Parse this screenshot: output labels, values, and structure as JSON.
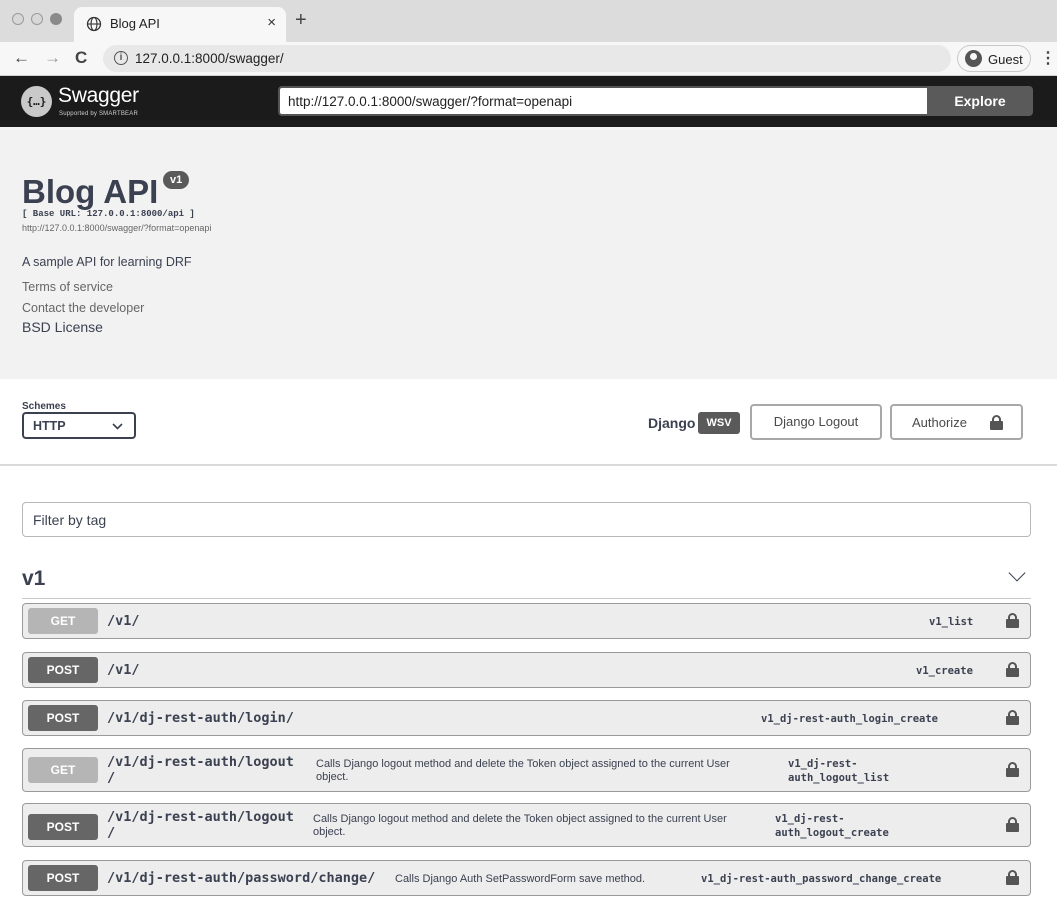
{
  "browser": {
    "tab_title": "Blog API",
    "tab_close": "×",
    "new_tab": "+",
    "back": "←",
    "forward": "→",
    "reload": "C",
    "info": "i",
    "url": "127.0.0.1:8000/swagger/",
    "profile_label": "Guest",
    "menu": "⋮"
  },
  "topbar": {
    "logo_glyph": "{…}",
    "logo_text": "Swagger",
    "logo_sub": "Supported by SMARTBEAR",
    "spec_url": "http://127.0.0.1:8000/swagger/?format=openapi",
    "explore_label": "Explore"
  },
  "info": {
    "title": "Blog API",
    "version": "v1",
    "base_url": "[ Base URL: 127.0.0.1:8000/api ]",
    "spec_link": "http://127.0.0.1:8000/swagger/?format=openapi",
    "description": "A sample API for learning DRF",
    "terms": "Terms of service",
    "contact": "Contact the developer",
    "license": "BSD License"
  },
  "schemes": {
    "label": "Schemes",
    "selected": "HTTP",
    "django_label": "Django",
    "wsv_badge": "WSV",
    "logout_label": "Django Logout",
    "authorize_label": "Authorize"
  },
  "filter": {
    "placeholder": "Filter by tag"
  },
  "tag": {
    "name": "v1"
  },
  "operations": [
    {
      "method": "GET",
      "path": "/v1/",
      "summary": "",
      "operation_id": "v1_list"
    },
    {
      "method": "POST",
      "path": "/v1/",
      "summary": "",
      "operation_id": "v1_create"
    },
    {
      "method": "POST",
      "path": "/v1/dj-rest-auth/login/",
      "summary": "",
      "operation_id": "v1_dj-rest-auth_login_create"
    },
    {
      "method": "GET",
      "path_line1": "/v1/dj-rest-auth/logout",
      "path_line2": "/",
      "summary": "Calls Django logout method and delete the Token object assigned to the current User object.",
      "opid_line1": "v1_dj-rest-",
      "opid_line2": "auth_logout_list"
    },
    {
      "method": "POST",
      "path_line1": "/v1/dj-rest-auth/logout",
      "path_line2": "/",
      "summary": "Calls Django logout method and delete the Token object assigned to the current User object.",
      "opid_line1": "v1_dj-rest-",
      "opid_line2": "auth_logout_create"
    },
    {
      "method": "POST",
      "path": "/v1/dj-rest-auth/password/change/",
      "summary": "Calls Django Auth SetPasswordForm save method.",
      "operation_id": "v1_dj-rest-auth_password_change_create"
    }
  ],
  "colors": {
    "topbar_bg": "#1b1b1b",
    "get_method": "#b5b5b5",
    "post_method": "#666666",
    "info_bg": "#f2f2f2"
  }
}
